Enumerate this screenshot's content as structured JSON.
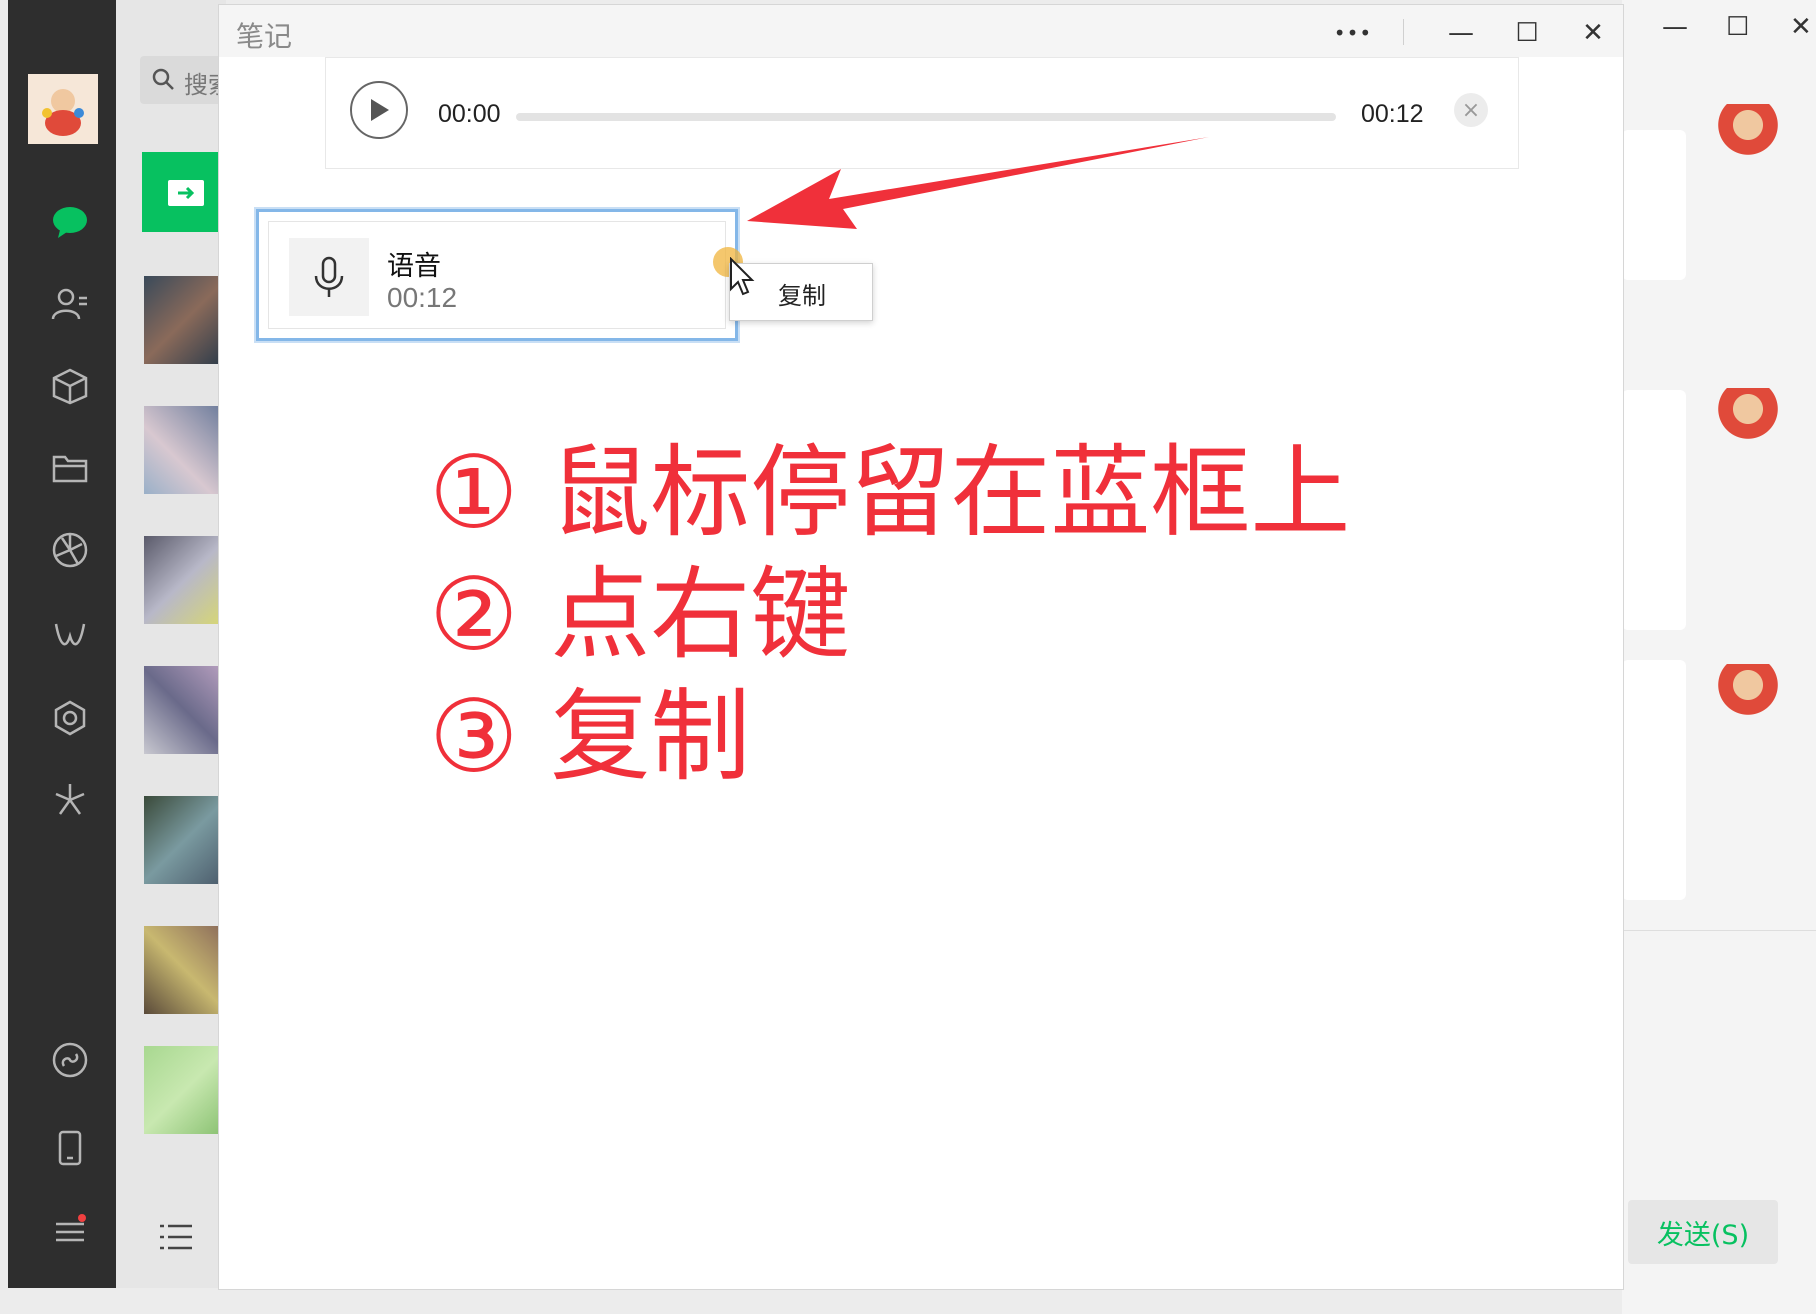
{
  "notes_window": {
    "title": "笔记",
    "more_label": "•••",
    "minimize_label": "—",
    "maximize_label": "☐",
    "close_label": "✕"
  },
  "audio_player": {
    "current_time": "00:00",
    "total_time": "00:12",
    "progress": 0,
    "close_label": "×"
  },
  "voice_note": {
    "label": "语音",
    "duration": "00:12"
  },
  "context_menu": {
    "items": [
      "复制"
    ]
  },
  "instructions": [
    "① 鼠标停留在蓝框上",
    "② 点右键",
    "③ 复制"
  ],
  "chat_list": {
    "search_placeholder": "搜索"
  },
  "right_pane": {
    "send_label": "发送(S)"
  },
  "colors": {
    "accent_green": "#07c160",
    "instruction_red": "#f0303a",
    "selection_blue": "#84b7e8",
    "sidebar_dark": "#2e2e2e"
  }
}
